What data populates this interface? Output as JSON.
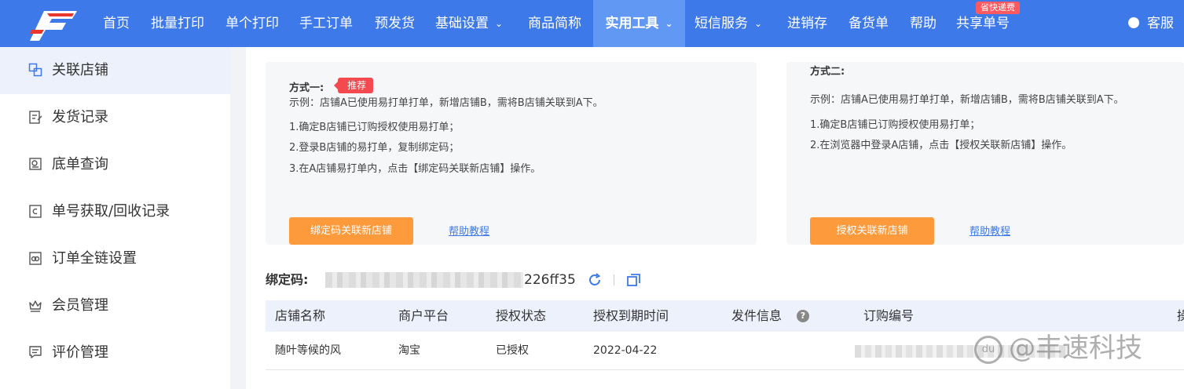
{
  "brand": {
    "logo_icon": "brand-f-logo-icon"
  },
  "nav": {
    "items": [
      "首页",
      "批量打印",
      "单个打印",
      "手工订单",
      "预发货",
      "基础设置",
      "商品简称",
      "实用工具",
      "短信服务",
      "进销存",
      "备货单",
      "帮助",
      "共享单号"
    ],
    "active": "实用工具",
    "hot_badge": "省快递费",
    "user": "客服"
  },
  "sidebar": {
    "items": [
      {
        "label": "关联店铺",
        "icon": "link-store-icon",
        "active": true
      },
      {
        "label": "发货记录",
        "icon": "clipboard-icon"
      },
      {
        "label": "底单查询",
        "icon": "search-record-icon"
      },
      {
        "label": "单号获取/回收记录",
        "icon": "recycle-doc-icon"
      },
      {
        "label": "订单全链设置",
        "icon": "chain-settings-icon"
      },
      {
        "label": "会员管理",
        "icon": "crown-icon"
      },
      {
        "label": "评价管理",
        "icon": "comment-icon"
      }
    ]
  },
  "method1": {
    "title": "方式一:",
    "badge": "推荐",
    "example": "示例：店铺A已使用易打单打单，新增店铺B，需将B店铺关联到A下。",
    "steps": [
      "1.确定B店铺已订购授权使用易打单；",
      "2.登录B店铺的易打单，复制绑定码；",
      "3.在A店铺易打单内，点击【绑定码关联新店铺】操作。"
    ],
    "button": "绑定码关联新店铺",
    "help": "帮助教程"
  },
  "method2": {
    "title": "方式二:",
    "example": "示例：店铺A已使用易打单打单，新增店铺B，需将B店铺关联到A下。",
    "steps": [
      "1.确定B店铺已订购授权使用易打单；",
      "2.在浏览器中登录A店铺，点击【授权关联新店铺】操作。"
    ],
    "button": "授权关联新店铺",
    "help": "帮助教程"
  },
  "binding": {
    "label": "绑定码:",
    "visible_suffix": "226ff35"
  },
  "table": {
    "headers": [
      "店铺名称",
      "商户平台",
      "授权状态",
      "授权到期时间",
      "发件信息",
      "订购编号",
      "操"
    ],
    "rows": [
      {
        "store": "随叶等候的风",
        "platform": "淘宝",
        "status": "已授权",
        "expiry": "2022-04-22"
      }
    ]
  },
  "watermark": {
    "text": "@丰速科技",
    "logo": "du"
  },
  "colors": {
    "primary": "#3d79e8",
    "nav_active": "#6198f3",
    "accent_orange": "#fd9a3c",
    "badge_red": "#f44a4f"
  }
}
